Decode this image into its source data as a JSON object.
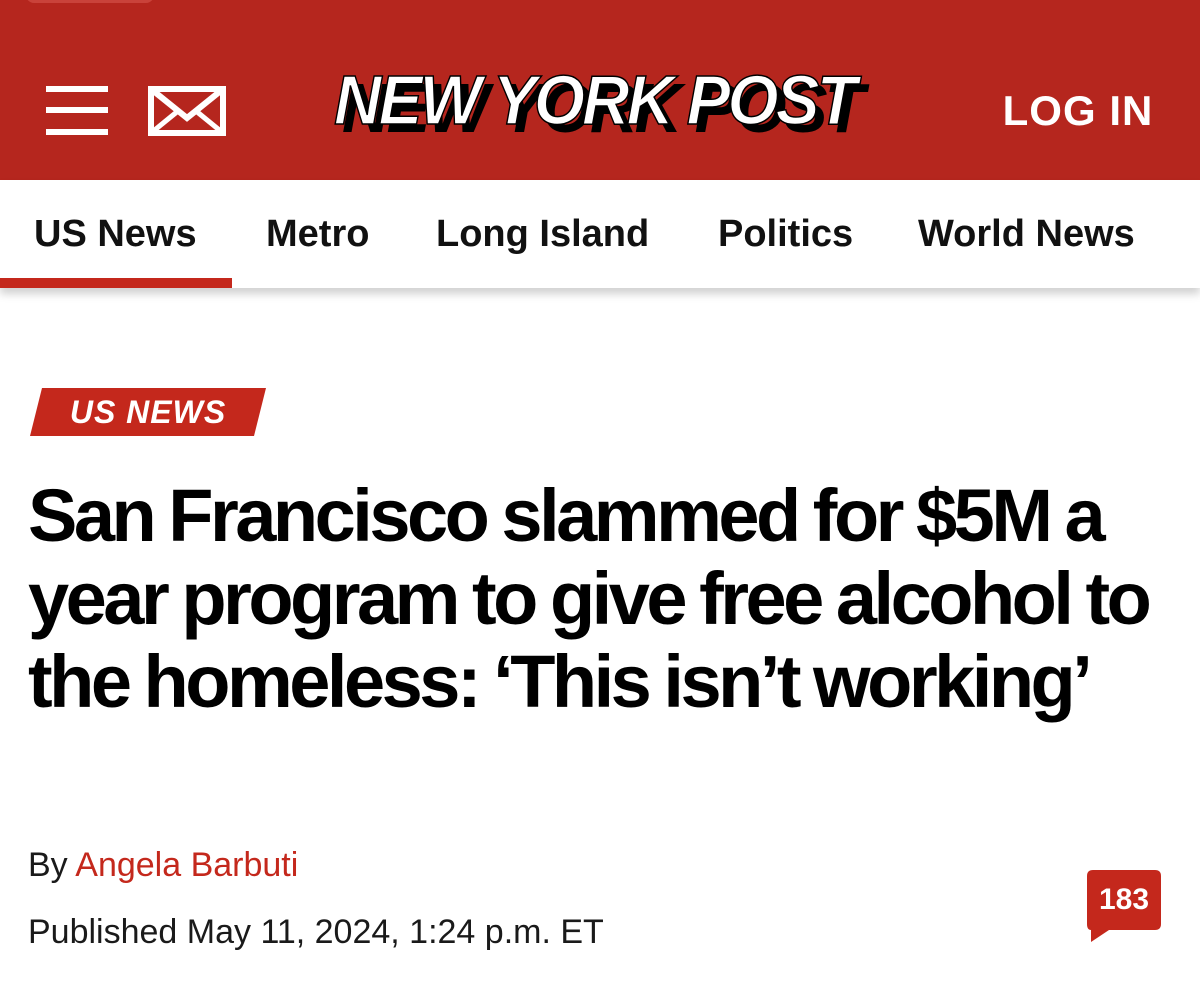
{
  "header": {
    "logo_text": "NEW YORK POST",
    "login_label": "LOG IN",
    "brand_color": "#b5261e",
    "icons": [
      "menu-icon",
      "mail-icon"
    ]
  },
  "nav": {
    "items": [
      {
        "label": "US News",
        "active": true
      },
      {
        "label": "Metro"
      },
      {
        "label": "Long Island"
      },
      {
        "label": "Politics"
      },
      {
        "label": "World News"
      }
    ],
    "accent_color": "#c4281c"
  },
  "article": {
    "section_tag": "US NEWS",
    "headline": "San Francisco slammed for $5M a year program to give free alcohol to the homeless: ‘This isn’t working’",
    "byline_prefix": "By",
    "author": "Angela Barbuti",
    "published": "Published May 11, 2024, 1:24 p.m. ET",
    "comment_count": "183"
  }
}
